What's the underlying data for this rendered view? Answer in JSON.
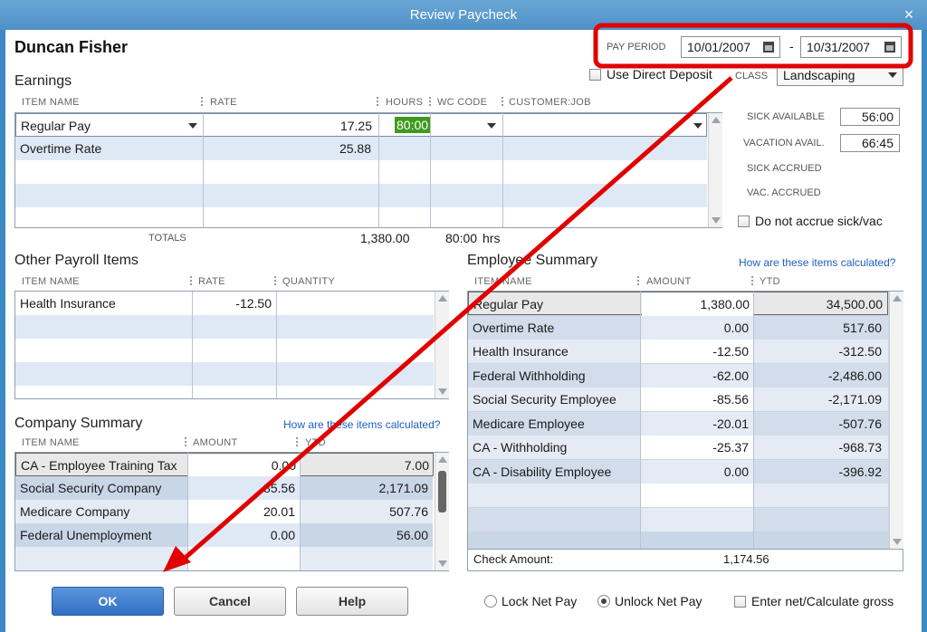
{
  "window": {
    "title": "Review Paycheck",
    "close_glyph": "×"
  },
  "employee_name": "Duncan Fisher",
  "pay_period": {
    "label": "PAY PERIOD",
    "start": "10/01/2007",
    "dash": "-",
    "end": "10/31/2007"
  },
  "direct_deposit": {
    "label": "Use Direct Deposit",
    "checked": false
  },
  "class": {
    "label": "CLASS",
    "value": "Landscaping"
  },
  "earnings": {
    "title": "Earnings",
    "headers": {
      "item": "ITEM NAME",
      "rate": "RATE",
      "hours": "HOURS",
      "wc": "WC CODE",
      "customer": "CUSTOMER:JOB"
    },
    "rows": [
      {
        "item": "Regular Pay",
        "rate": "17.25",
        "hours": "80:00",
        "wc": "",
        "customer": ""
      },
      {
        "item": "Overtime Rate",
        "rate": "25.88",
        "hours": "",
        "wc": "",
        "customer": ""
      }
    ],
    "totals_label": "TOTALS",
    "total_amount": "1,380.00",
    "total_hours": "80:00",
    "hours_unit": "hrs"
  },
  "sick_vacation": {
    "sick_available_label": "SICK AVAILABLE",
    "sick_available": "56:00",
    "vacation_avail_label": "VACATION AVAIL.",
    "vacation_avail": "66:45",
    "sick_accrued_label": "SICK ACCRUED",
    "vac_accrued_label": "VAC. ACCRUED",
    "do_not_accrue_label": "Do not accrue sick/vac"
  },
  "other_payroll": {
    "title": "Other Payroll Items",
    "headers": {
      "item": "ITEM NAME",
      "rate": "RATE",
      "quantity": "QUANTITY"
    },
    "rows": [
      {
        "item": "Health Insurance",
        "rate": "-12.50",
        "quantity": ""
      }
    ]
  },
  "company_summary": {
    "title": "Company Summary",
    "link": "How are these items calculated?",
    "headers": {
      "item": "ITEM NAME",
      "amount": "AMOUNT",
      "ytd": "YTD"
    },
    "rows": [
      {
        "item": "CA - Employee Training Tax",
        "amount": "0.00",
        "ytd": "7.00"
      },
      {
        "item": "Social Security Company",
        "amount": "85.56",
        "ytd": "2,171.09"
      },
      {
        "item": "Medicare Company",
        "amount": "20.01",
        "ytd": "507.76"
      },
      {
        "item": "Federal Unemployment",
        "amount": "0.00",
        "ytd": "56.00"
      }
    ]
  },
  "employee_summary": {
    "title": "Employee Summary",
    "link": "How are these items calculated?",
    "headers": {
      "item": "ITEM NAME",
      "amount": "AMOUNT",
      "ytd": "YTD"
    },
    "rows": [
      {
        "item": "Regular Pay",
        "amount": "1,380.00",
        "ytd": "34,500.00"
      },
      {
        "item": "Overtime Rate",
        "amount": "0.00",
        "ytd": "517.60"
      },
      {
        "item": "Health Insurance",
        "amount": "-12.50",
        "ytd": "-312.50"
      },
      {
        "item": "Federal Withholding",
        "amount": "-62.00",
        "ytd": "-2,486.00"
      },
      {
        "item": "Social Security Employee",
        "amount": "-85.56",
        "ytd": "-2,171.09"
      },
      {
        "item": "Medicare Employee",
        "amount": "-20.01",
        "ytd": "-507.76"
      },
      {
        "item": "CA - Withholding",
        "amount": "-25.37",
        "ytd": "-968.73"
      },
      {
        "item": "CA - Disability Employee",
        "amount": "0.00",
        "ytd": "-396.92"
      }
    ],
    "check_amount_label": "Check Amount:",
    "check_amount": "1,174.56"
  },
  "buttons": {
    "ok": "OK",
    "cancel": "Cancel",
    "help": "Help"
  },
  "net_pay": {
    "lock_label": "Lock Net Pay",
    "unlock_label": "Unlock Net Pay",
    "selected": "unlock",
    "enter_net_label": "Enter net/Calculate gross"
  },
  "annotation": {
    "highlight_color": "#e00000"
  }
}
